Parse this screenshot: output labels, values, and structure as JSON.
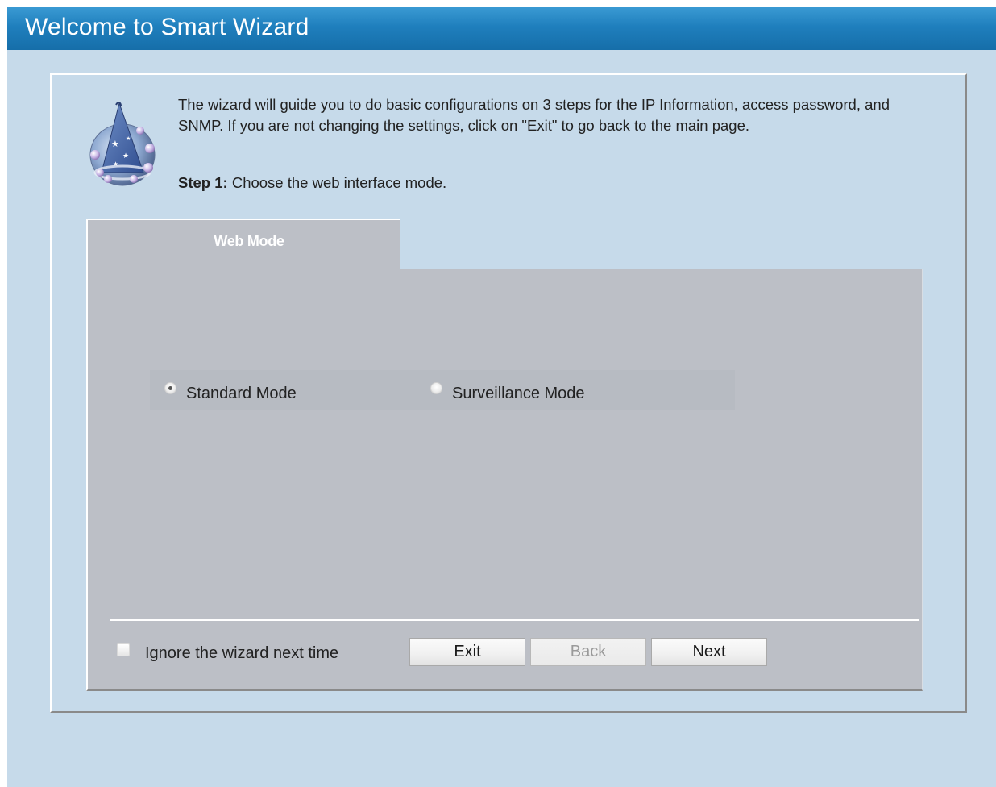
{
  "header": {
    "title": "Welcome to Smart Wizard"
  },
  "intro": {
    "text": "The wizard will guide you to do basic configurations on 3 steps for the IP Information, access password, and SNMP. If you are not changing the settings, click on \"Exit\" to go back to the main page.",
    "step_label": "Step 1:",
    "step_text": " Choose the web interface mode."
  },
  "tab": {
    "label": "Web Mode"
  },
  "modes": {
    "standard_label": "Standard Mode",
    "surveillance_label": "Surveillance Mode",
    "selected": "Standard Mode"
  },
  "footer": {
    "ignore_label": "Ignore the wizard next time",
    "ignore_checked": false,
    "exit_label": "Exit",
    "back_label": "Back",
    "next_label": "Next",
    "back_enabled": false
  },
  "icons": {
    "wizard": "wizard-hat-icon"
  },
  "colors": {
    "title_bar": "#1f7fbd",
    "background": "#c6daea",
    "content_panel": "#bcbfc6"
  }
}
